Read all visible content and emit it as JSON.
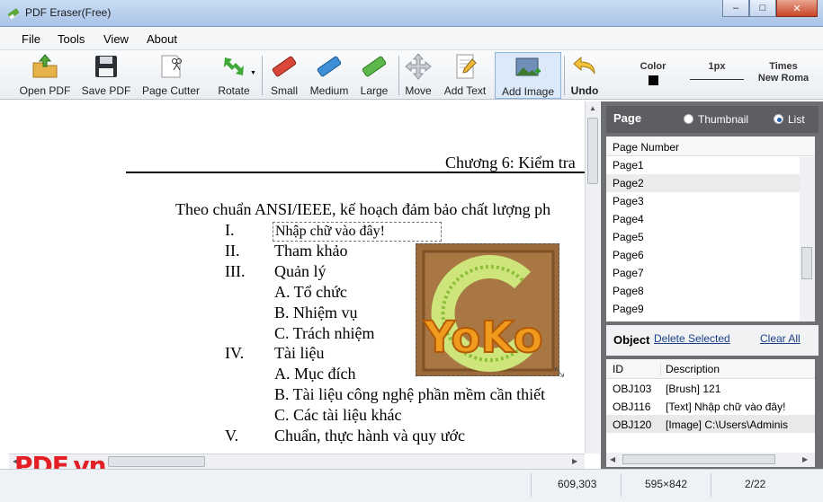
{
  "window": {
    "title": "PDF Eraser(Free)",
    "min": "‒",
    "max": "□",
    "close": "✕"
  },
  "menu": [
    "File",
    "Tools",
    "View",
    "About"
  ],
  "toolbar": {
    "open": "Open PDF",
    "save": "Save PDF",
    "cutter": "Page Cutter",
    "rotate": "Rotate",
    "small": "Small",
    "medium": "Medium",
    "large": "Large",
    "move": "Move",
    "add_text": "Add Text",
    "add_image": "Add Image",
    "undo": "Undo",
    "color": "Color",
    "size": "1px",
    "font": "Times New Roma",
    "font_line2": "New Roma",
    "font_line1": "Times"
  },
  "document": {
    "header": "Chương 6: Kiểm tra",
    "intro": "Theo chuẩn ANSI/IEEE, kế hoạch đảm bảo chất lượng ph",
    "outline": [
      {
        "num": "I.",
        "text": ""
      },
      {
        "num": "II.",
        "text": "Tham khảo"
      },
      {
        "num": "III.",
        "text": "Quản lý"
      },
      {
        "num": "",
        "text": "A.  Tổ chức"
      },
      {
        "num": "",
        "text": "B.  Nhiệm vụ"
      },
      {
        "num": "",
        "text": "C.  Trách nhiệm"
      },
      {
        "num": "IV.",
        "text": "Tài liệu"
      },
      {
        "num": "",
        "text": "A.  Mục đích"
      },
      {
        "num": "",
        "text": "B.  Tài liệu công nghệ phần mềm cần thiết"
      },
      {
        "num": "",
        "text": "C.  Các tài liệu khác"
      },
      {
        "num": "V.",
        "text": "Chuẩn, thực hành và quy ước"
      }
    ],
    "text_box": "Nhập chữ vào đây!",
    "image_label": "YoKo",
    "logo": "PDF.vn"
  },
  "page_panel": {
    "title": "Page",
    "thumbnail": "Thumbnail",
    "list": "List",
    "column": "Page Number",
    "pages": [
      "Page1",
      "Page2",
      "Page3",
      "Page4",
      "Page5",
      "Page6",
      "Page7",
      "Page8",
      "Page9"
    ]
  },
  "object_panel": {
    "title": "Object",
    "delete_selected": "Delete Selected",
    "clear_all": "Clear All",
    "col_id": "ID",
    "col_desc": "Description",
    "rows": [
      {
        "id": "OBJ103",
        "desc": "[Brush] 121"
      },
      {
        "id": "OBJ116",
        "desc": "[Text] Nhập chữ vào đây!"
      },
      {
        "id": "OBJ120",
        "desc": "[Image] C:\\Users\\Adminis"
      }
    ]
  },
  "status": {
    "coords": "609,303",
    "page_size": "595×842",
    "page": "2/22"
  },
  "colors": {
    "accent": "#2b5ea8",
    "panel": "#6d6f73",
    "logo": "#e31e24"
  }
}
